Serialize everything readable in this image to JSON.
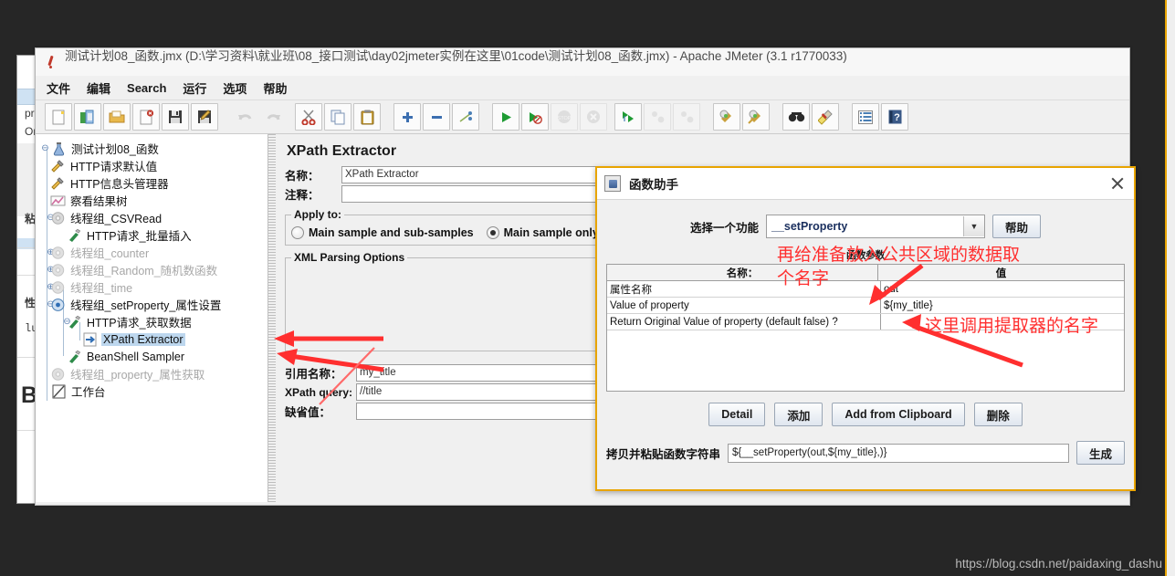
{
  "window": {
    "title": "测试计划08_函数.jmx (D:\\学习资料\\就业班\\08_接口测试\\day02jmeter实例在这里\\01code\\测试计划08_函数.jmx) - Apache JMeter (3.1 r1770033)",
    "menu": [
      "文件",
      "编辑",
      "Search",
      "运行",
      "选项",
      "帮助"
    ]
  },
  "toolbar": {
    "buttons": [
      {
        "name": "new-icon",
        "glyph": "🗋"
      },
      {
        "name": "templates-icon",
        "glyph": "📗"
      },
      {
        "name": "open-icon",
        "glyph": "📂"
      },
      {
        "name": "close-icon",
        "glyph": "🗏"
      },
      {
        "name": "save-icon",
        "glyph": "💾"
      },
      {
        "name": "save-as-icon",
        "glyph": "📝"
      },
      {
        "name": "undo-icon",
        "glyph": "↩"
      },
      {
        "name": "redo-icon",
        "glyph": "↪"
      },
      {
        "name": "cut-icon",
        "glyph": "✂"
      },
      {
        "name": "copy-icon",
        "glyph": "⧉"
      },
      {
        "name": "paste-icon",
        "glyph": "📋"
      },
      {
        "name": "expand-icon",
        "glyph": "＋"
      },
      {
        "name": "collapse-icon",
        "glyph": "−"
      },
      {
        "name": "toggle-icon",
        "glyph": "⚡"
      },
      {
        "name": "start-icon",
        "glyph": "▶"
      },
      {
        "name": "start-no-pauses-icon",
        "glyph": "▶"
      },
      {
        "name": "stop-icon",
        "glyph": "⛔"
      },
      {
        "name": "shutdown-icon",
        "glyph": "✖"
      },
      {
        "name": "start-remote-icon",
        "glyph": "▶▶"
      },
      {
        "name": "stop-remote-icon",
        "glyph": "◎"
      },
      {
        "name": "shutdown-remote-icon",
        "glyph": "◎"
      },
      {
        "name": "clear-icon",
        "glyph": "🧹"
      },
      {
        "name": "clear-all-icon",
        "glyph": "🧹"
      },
      {
        "name": "search-icon",
        "glyph": "🔍"
      },
      {
        "name": "reset-search-icon",
        "glyph": "🖌"
      },
      {
        "name": "function-helper-icon",
        "glyph": "☰"
      },
      {
        "name": "help-icon",
        "glyph": "?"
      }
    ]
  },
  "tree": {
    "nodes": [
      {
        "label": "测试计划08_函数",
        "indent": 0,
        "icon": "test-plan-icon",
        "disabled": false,
        "selected": false,
        "handle": "o"
      },
      {
        "label": "HTTP请求默认值",
        "indent": 1,
        "icon": "config-element-icon",
        "disabled": false,
        "selected": false,
        "handle": ""
      },
      {
        "label": "HTTP信息头管理器",
        "indent": 1,
        "icon": "config-element-icon",
        "disabled": false,
        "selected": false,
        "handle": ""
      },
      {
        "label": "察看结果树",
        "indent": 1,
        "icon": "view-results-tree-icon",
        "disabled": false,
        "selected": false,
        "handle": ""
      },
      {
        "label": "线程组_CSVRead",
        "indent": 1,
        "icon": "thread-group-icon",
        "disabled": true,
        "selected": false,
        "handle": "o"
      },
      {
        "label": "HTTP请求_批量插入",
        "indent": 2,
        "icon": "http-sampler-icon",
        "disabled": false,
        "selected": false,
        "handle": ""
      },
      {
        "label": "线程组_counter",
        "indent": 1,
        "icon": "thread-group-icon",
        "disabled": true,
        "selected": false,
        "handle": "o-"
      },
      {
        "label": "线程组_Random_随机数函数",
        "indent": 1,
        "icon": "thread-group-icon",
        "disabled": true,
        "selected": false,
        "handle": "o-"
      },
      {
        "label": "线程组_time",
        "indent": 1,
        "icon": "thread-group-icon",
        "disabled": true,
        "selected": false,
        "handle": "o-"
      },
      {
        "label": "线程组_setProperty_属性设置",
        "indent": 1,
        "icon": "thread-group-icon",
        "disabled": false,
        "selected": false,
        "handle": "o"
      },
      {
        "label": "HTTP请求_获取数据",
        "indent": 2,
        "icon": "http-sampler-icon",
        "disabled": false,
        "selected": false,
        "handle": "o"
      },
      {
        "label": "XPath Extractor",
        "indent": 3,
        "icon": "xpath-extractor-icon",
        "disabled": false,
        "selected": true,
        "handle": ""
      },
      {
        "label": "BeanShell Sampler",
        "indent": 2,
        "icon": "beanshell-sampler-icon",
        "disabled": false,
        "selected": false,
        "handle": ""
      },
      {
        "label": "线程组_property_属性获取",
        "indent": 1,
        "icon": "thread-group-icon",
        "disabled": true,
        "selected": false,
        "handle": ""
      },
      {
        "label": "工作台",
        "indent": 0,
        "icon": "workbench-icon",
        "disabled": false,
        "selected": false,
        "handle": ""
      }
    ]
  },
  "xpath_panel": {
    "title": "XPath Extractor",
    "name_label": "名称：",
    "name_value": "XPath Extractor",
    "comment_label": "注释：",
    "comment_value": "",
    "apply_to_legend": "Apply to:",
    "radio_main_sub": "Main sample and sub-samples",
    "radio_main": "Main sample only",
    "radio_selected": "main",
    "xml_parsing_legend": "XML Parsing Options",
    "ref_name_label": "引用名称：",
    "ref_name_value": "my_title",
    "xpath_query_label": "XPath query:",
    "xpath_query_value": "//title",
    "default_value_label": "缺省值：",
    "default_value": ""
  },
  "dialog": {
    "title": "函数助手",
    "select_function_label": "选择一个功能",
    "selected_function": "__setProperty",
    "help_button": "帮助",
    "params_title": "函数参数",
    "table": {
      "headers": [
        "名称：",
        "值"
      ],
      "rows": [
        {
          "name": "属性名称",
          "value": "out"
        },
        {
          "name": "Value of property",
          "value": "${my_title}"
        },
        {
          "name": "Return Original Value of property (default false) ?",
          "value": ""
        }
      ]
    },
    "buttons": [
      "Detail",
      "添加",
      "Add from Clipboard",
      "删除"
    ],
    "generate_label": "拷贝并粘贴函数字符串",
    "generate_value": "${__setProperty(out,${my_title},)}",
    "generate_button": "生成"
  },
  "annotations": [
    {
      "name": "annotation-name-the-data",
      "text": "再给准备备放入公共区域的数据取",
      "line2": "个名字"
    },
    {
      "name": "annotation-extractor-name",
      "text": "这里调用提取器的名字"
    }
  ],
  "annotation_texts": {
    "naming_line1": "再给准备放入公共区域的数据取",
    "naming_line2": "个名字",
    "extractor": "这里调用提取器的名字"
  },
  "background_window": {
    "frag1": "prope",
    "frag2": "Origina",
    "frag3": "粘贴函",
    "frag4": "性名称",
    "frag5": "lue o",
    "frag6": "Bean"
  },
  "watermark": "https://blog.csdn.net/paidaxing_dashu",
  "colors": {
    "accent": "#e8a400",
    "annotation": "#ff2f2f",
    "selection": "#bdd7ee",
    "background": "#262626"
  }
}
